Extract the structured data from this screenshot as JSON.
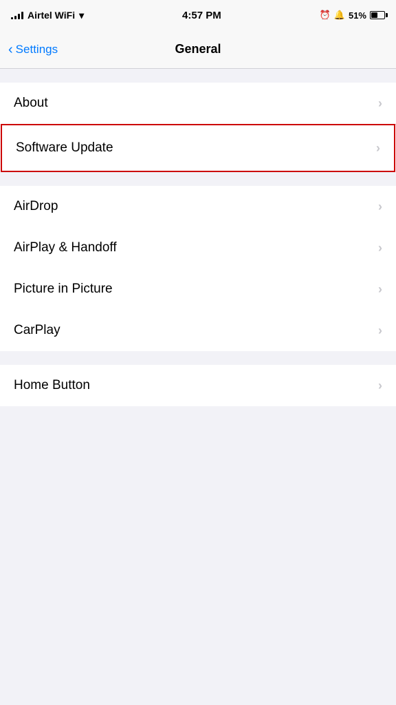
{
  "statusBar": {
    "carrier": "Airtel WiFi",
    "time": "4:57 PM",
    "battery_percent": "51%"
  },
  "navBar": {
    "back_label": "Settings",
    "title": "General"
  },
  "groups": [
    {
      "id": "group1",
      "items": [
        {
          "id": "about",
          "label": "About",
          "highlighted": false
        },
        {
          "id": "software-update",
          "label": "Software Update",
          "highlighted": true
        }
      ]
    },
    {
      "id": "group2",
      "items": [
        {
          "id": "airdrop",
          "label": "AirDrop",
          "highlighted": false
        },
        {
          "id": "airplay-handoff",
          "label": "AirPlay & Handoff",
          "highlighted": false
        },
        {
          "id": "picture-in-picture",
          "label": "Picture in Picture",
          "highlighted": false
        },
        {
          "id": "carplay",
          "label": "CarPlay",
          "highlighted": false
        }
      ]
    },
    {
      "id": "group3",
      "items": [
        {
          "id": "home-button",
          "label": "Home Button",
          "highlighted": false
        }
      ]
    }
  ],
  "icons": {
    "chevron_right": "›",
    "back_chevron": "‹"
  }
}
